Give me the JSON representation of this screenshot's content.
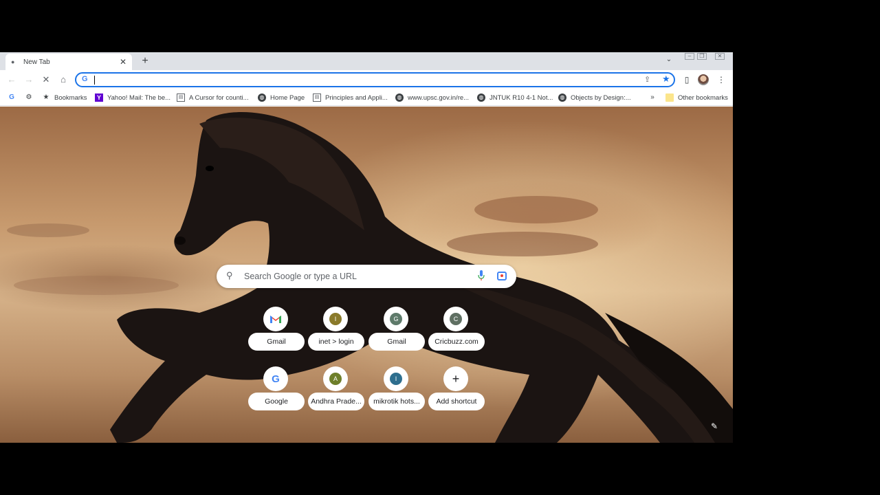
{
  "tab": {
    "title": "New Tab"
  },
  "omnibox": {
    "value": ""
  },
  "bookmarks": [
    {
      "label": "Bookmarks",
      "icon": "star-icon"
    },
    {
      "label": "Yahoo! Mail: The be...",
      "icon": "yahoo-icon"
    },
    {
      "label": "A Cursor for counti...",
      "icon": "page-icon"
    },
    {
      "label": "Home Page",
      "icon": "globe-icon"
    },
    {
      "label": "Principles and Appli...",
      "icon": "page-icon"
    },
    {
      "label": "www.upsc.gov.in/re...",
      "icon": "globe-icon"
    },
    {
      "label": "JNTUK R10 4-1 Not...",
      "icon": "globe-icon"
    },
    {
      "label": "Objects by Design:...",
      "icon": "globe-icon"
    }
  ],
  "other_bookmarks": "Other bookmarks",
  "search": {
    "placeholder": "Search Google or type a URL"
  },
  "shortcuts": [
    {
      "label": "Gmail",
      "icon": "gmail-icon"
    },
    {
      "label": "inet > login",
      "letter": "I",
      "color": "#8a7a2a"
    },
    {
      "label": "Gmail",
      "letter": "G",
      "color": "#5e7a6a"
    },
    {
      "label": "Cricbuzz.com",
      "letter": "C",
      "color": "#5f6f62"
    },
    {
      "label": "Google",
      "icon": "google-icon"
    },
    {
      "label": "Andhra Prade...",
      "letter": "A",
      "color": "#6e7f2a"
    },
    {
      "label": "mikrotik hots...",
      "letter": "I",
      "color": "#2e6e8e"
    },
    {
      "label": "Add shortcut",
      "icon": "plus-icon"
    }
  ]
}
